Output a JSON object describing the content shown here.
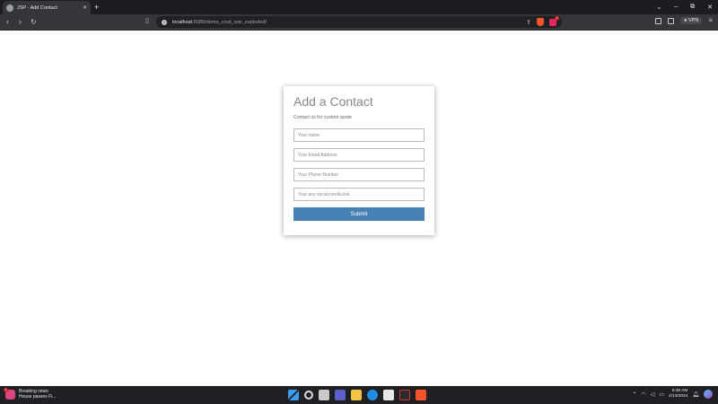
{
  "browser": {
    "tab_title": "JSP - Add Contact",
    "tab_close": "✕",
    "new_tab": "+",
    "url_host": "localhost",
    "url_path": ":8080/demo_crud_war_exploded/",
    "vpn_label": "● VPN",
    "rewards_badge": "1",
    "nav_back": "‹",
    "nav_forward": "›",
    "reload": "↻",
    "win_minimize": "–",
    "win_restore": "⧉",
    "win_close": "✕",
    "win_dropdown": "⌄"
  },
  "form": {
    "title": "Add a Contact",
    "subtitle": "Contact us for custom quote",
    "name_placeholder": "Your name",
    "email_placeholder": "Your Email Address",
    "phone_placeholder": "Your Phone Number",
    "social_placeholder": "Your any social media link",
    "submit_label": "Submit"
  },
  "taskbar": {
    "news_title": "Breaking news",
    "news_subtitle": "House passes Fi...",
    "news_badge": "1",
    "time": "8:38 AM",
    "date": "4/13/2024"
  },
  "colors": {
    "submit_bg": "#4682b4",
    "tab_bg": "#35363a",
    "taskbar_bg": "#1f2024"
  }
}
